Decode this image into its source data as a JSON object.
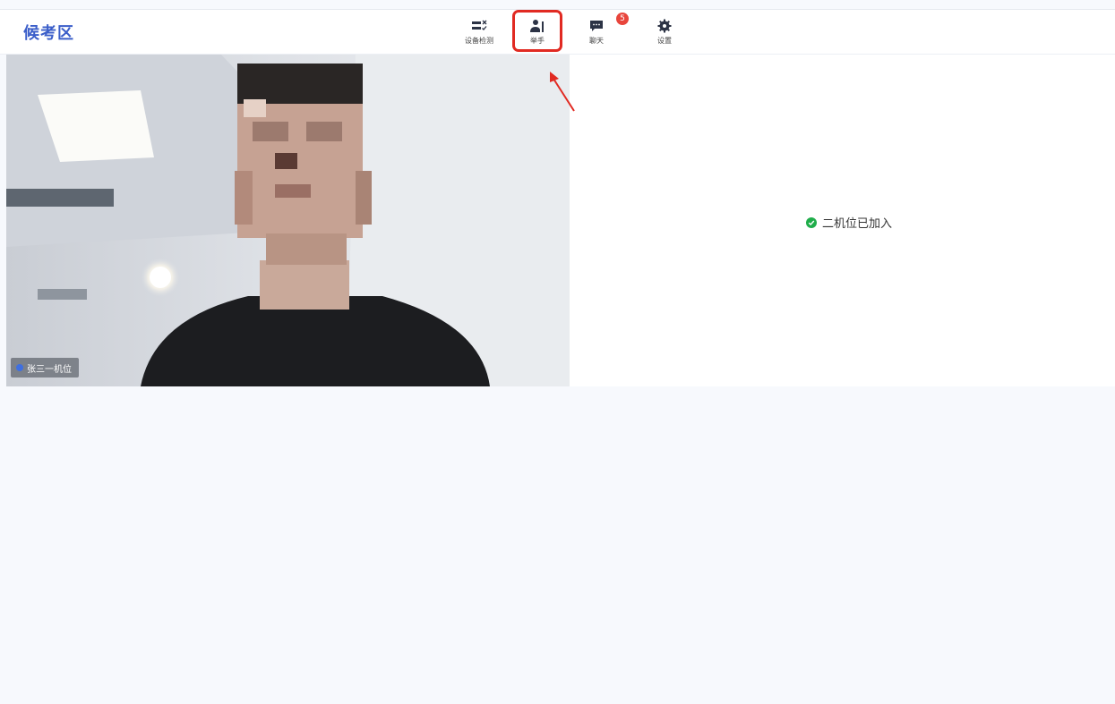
{
  "header": {
    "title": "候考区",
    "tools": {
      "device_check": "设备检测",
      "raise_hand": "举手",
      "chat": "聊天",
      "settings": "设置"
    },
    "chat_badge": "5"
  },
  "video": {
    "camera_label": "张三一机位"
  },
  "right_panel": {
    "status": "二机位已加入"
  },
  "colors": {
    "accent": "#3b5ec9",
    "highlight": "#e12a22",
    "badge": "#e8453c",
    "success": "#1fad4a"
  }
}
